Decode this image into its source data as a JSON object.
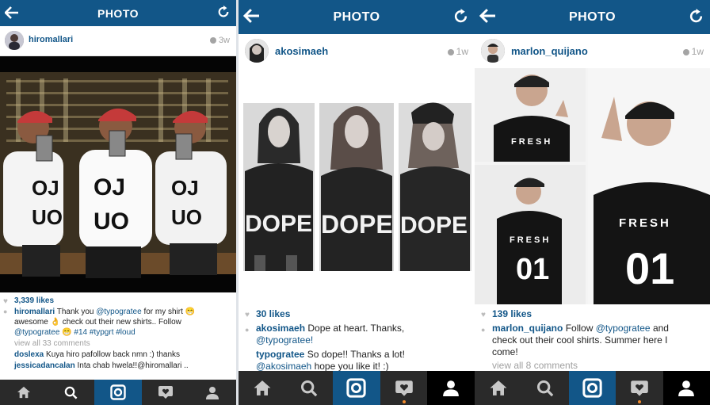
{
  "panels": [
    {
      "title": "PHOTO",
      "username": "hiromallari",
      "time_ago": "3w",
      "likes": "3,339 likes",
      "caption_user": "hiromallari",
      "caption_text_1": "Thank you",
      "caption_mention": "@typogratee",
      "caption_text_2": "for my shirt 😁 awesome 👌 check out their new shirts.. Follow",
      "caption_mention_2": "@typogratee",
      "caption_tags": "😁 #14 #typgrt #loud",
      "view_all": "view all 33 comments",
      "comments": [
        {
          "user": "doslexa",
          "text": "Kuya hiro pafollow back nmn :) thanks"
        },
        {
          "user": "jessicadancalan",
          "text": "Inta chab hwela!!@hiromallari .."
        }
      ],
      "photo_shirt_text": "OJ UO"
    },
    {
      "title": "PHOTO",
      "username": "akosimaeh",
      "time_ago": "1w",
      "likes": "30 likes",
      "caption_user": "akosimaeh",
      "caption_text": "Dope at heart. Thanks,",
      "caption_mention": "@typogratee!",
      "comment_user": "typogratee",
      "comment_text": "So dope!! Thanks a lot!",
      "comment_mention": "@akosimaeh",
      "comment_text_2": "hope you like it! :)",
      "photo_shirt_text": "DOPE"
    },
    {
      "title": "PHOTO",
      "username": "marlon_quijano",
      "time_ago": "1w",
      "likes": "139 likes",
      "caption_user": "marlon_quijano",
      "caption_text_1": "Follow",
      "caption_mention": "@typogratee",
      "caption_text_2": "and check out their cool shirts. Summer here I come!",
      "view_all": "view all 8 comments",
      "photo_shirt_text": "FRESH",
      "photo_shirt_number": "01"
    }
  ],
  "tabs": [
    "home-icon",
    "search-icon",
    "camera-icon",
    "activity-icon",
    "profile-icon"
  ],
  "colors": {
    "header": "#125688",
    "tabbar": "#2a2a2a",
    "link": "#125688",
    "active_tab": "#125688"
  }
}
